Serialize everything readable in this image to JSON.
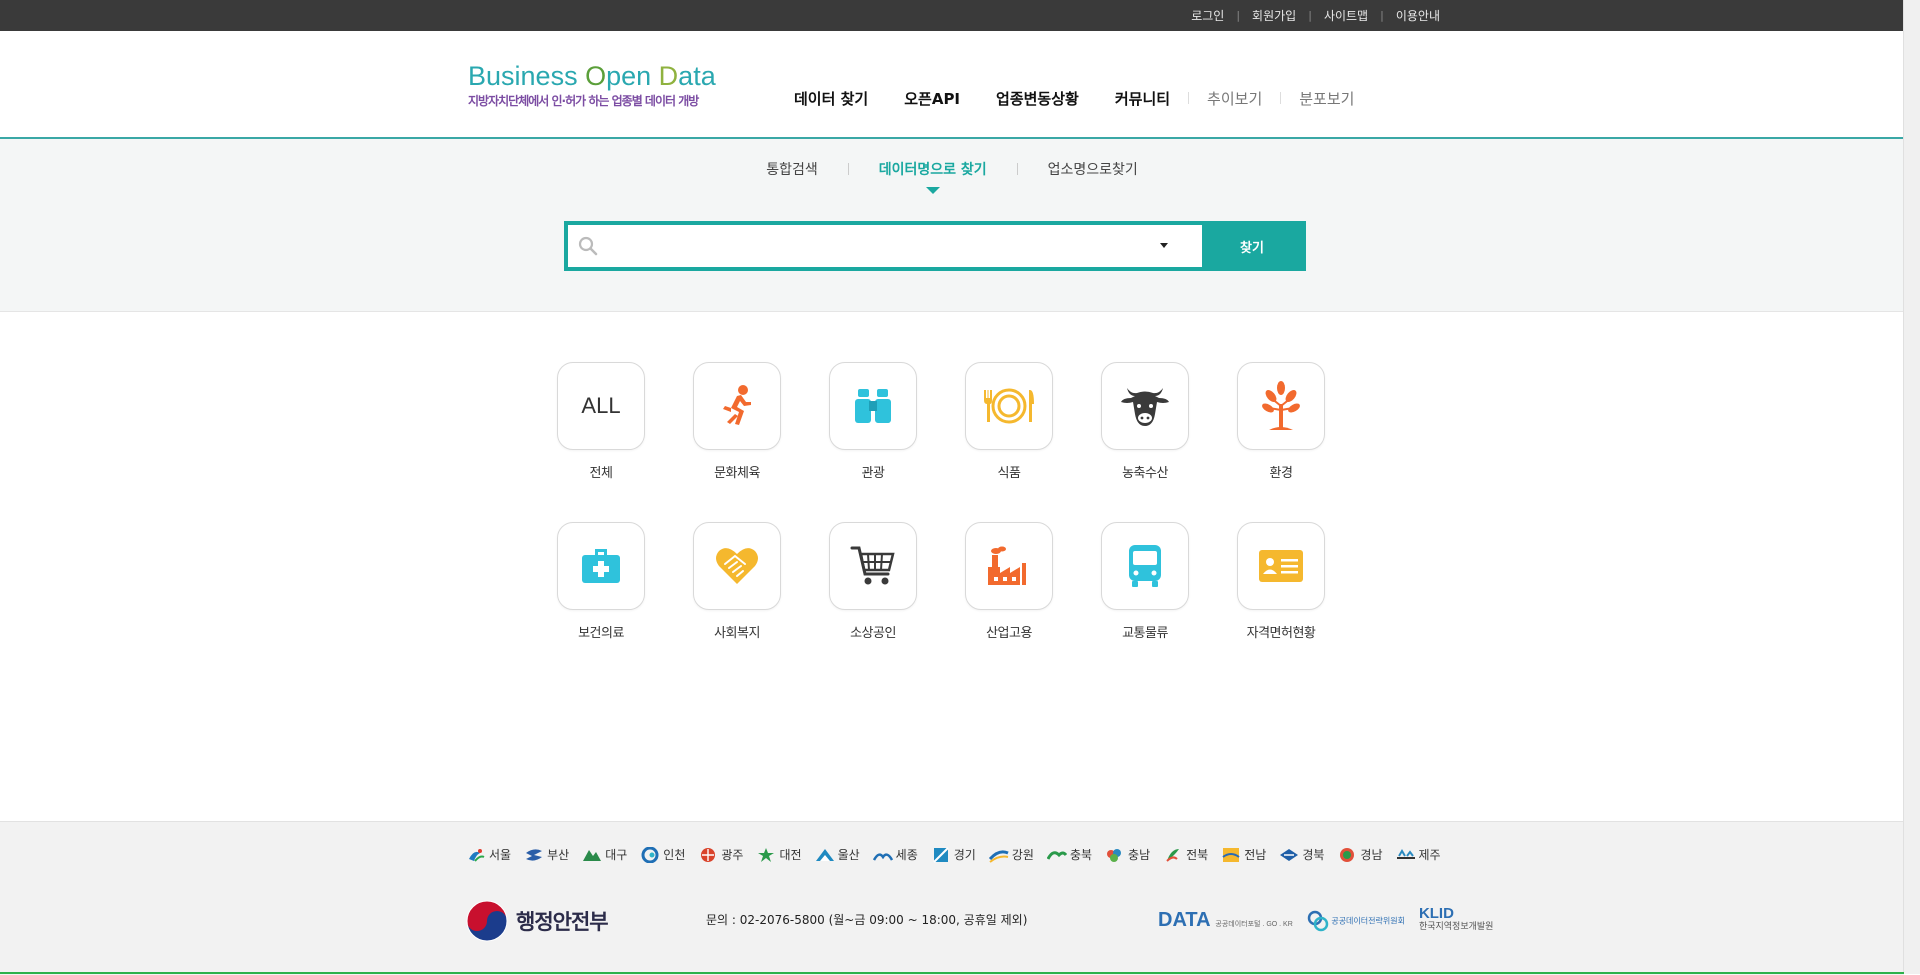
{
  "topbar": {
    "links": [
      "로그인",
      "회원가입",
      "사이트맵",
      "이용안내"
    ]
  },
  "logo": {
    "title_b": "B",
    "title_usiness": "usiness",
    "title_o": "O",
    "title_pen": "pen",
    "title_d": "D",
    "title_ata": "ata",
    "subtitle": "지방자치단체에서 인·허가 하는 업종별 데이터 개방"
  },
  "gnb": {
    "items": [
      "데이터 찾기",
      "오픈API",
      "업종변동상황",
      "커뮤니티",
      "추이보기",
      "분포보기"
    ]
  },
  "search": {
    "tabs": [
      "통합검색",
      "데이터명으로 찾기",
      "업소명으로찾기"
    ],
    "active_tab": "데이터명으로 찾기",
    "input_value": "",
    "button_label": "찾기"
  },
  "categories": [
    {
      "label": "전체",
      "icon": "all-text",
      "text": "ALL"
    },
    {
      "label": "문화체육",
      "icon": "running-person-icon"
    },
    {
      "label": "관광",
      "icon": "binoculars-icon"
    },
    {
      "label": "식품",
      "icon": "plate-cutlery-icon"
    },
    {
      "label": "농축수산",
      "icon": "cow-icon"
    },
    {
      "label": "환경",
      "icon": "tree-icon"
    },
    {
      "label": "보건의료",
      "icon": "medical-kit-icon"
    },
    {
      "label": "사회복지",
      "icon": "heart-handshake-icon"
    },
    {
      "label": "소상공인",
      "icon": "shopping-cart-icon"
    },
    {
      "label": "산업고용",
      "icon": "factory-icon"
    },
    {
      "label": "교통물류",
      "icon": "bus-icon"
    },
    {
      "label": "자격면허현황",
      "icon": "id-card-icon"
    }
  ],
  "footer": {
    "regions": [
      "서울",
      "부산",
      "대구",
      "인천",
      "광주",
      "대전",
      "울산",
      "세종",
      "경기",
      "강원",
      "충북",
      "충남",
      "전북",
      "전남",
      "경북",
      "경남",
      "제주"
    ],
    "ministry": "행정안전부",
    "contact": "문의 : 02-2076-5800 (월~금 09:00 ~ 18:00, 공휴일 제외)",
    "partner_data": "DATA",
    "partner_data_sub": "공공데이터포털 . GO . KR",
    "partner_council": "공공데이터전략위원회",
    "partner_klid": "KLID",
    "partner_klid_sub": "한국지역정보개발원"
  },
  "colors": {
    "accent": "#1aa8a0",
    "topbar": "#3a3a3a",
    "orange": "#f26a2e",
    "cyan": "#2fc2dc",
    "yellow": "#f5b82e",
    "dark": "#3a3a3a"
  }
}
